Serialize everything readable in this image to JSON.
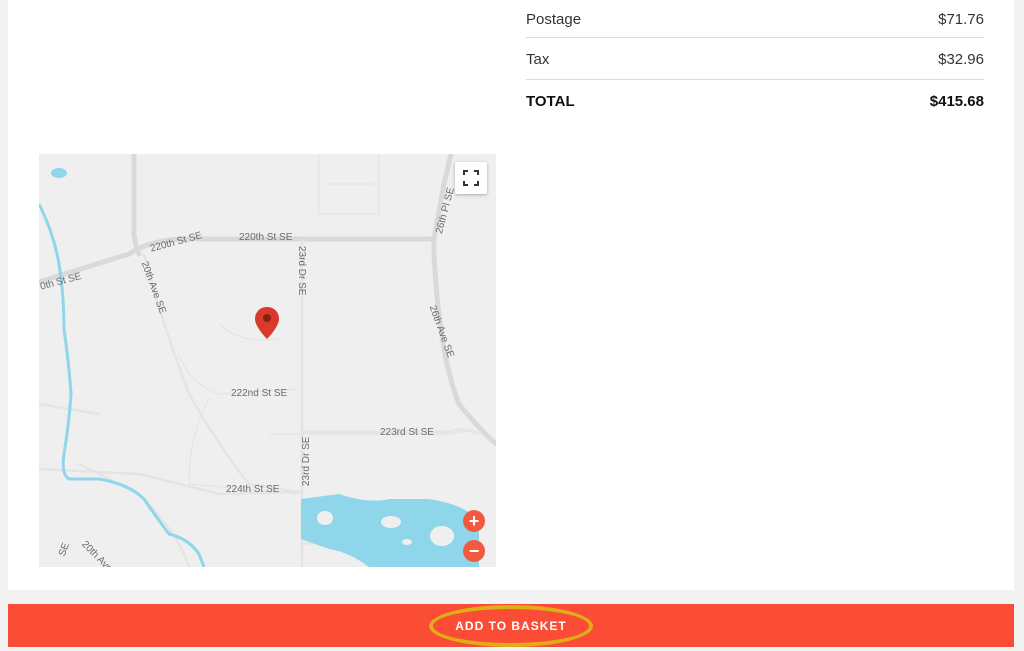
{
  "summary": {
    "postage_label": "Postage",
    "postage_value": "$71.76",
    "tax_label": "Tax",
    "tax_value": "$32.96",
    "total_label": "TOTAL",
    "total_value": "$415.68"
  },
  "map": {
    "roads": {
      "r220th_left": "220th St SE",
      "r220th_mid": "220th St SE",
      "r220th_edge": "0th St SE",
      "r20th_ave": "20th Ave SE",
      "r23rd_dr_top": "23rd Dr SE",
      "r23rd_dr_bottom": "23rd Dr SE",
      "r26th_pl": "26th Pl SE",
      "r26th_ave": "26th Ave SE",
      "r222nd": "222nd St SE",
      "r223rd": "223rd St SE",
      "r224th": "224th St SE",
      "r20th_ave_bottom": "20th Ave",
      "r_se_bottom": "SE"
    },
    "controls": {
      "zoom_in": "+",
      "zoom_out": "−"
    },
    "colors": {
      "water": "#8fd6ea",
      "marker": "#d93a2b",
      "background": "#efefef"
    }
  },
  "actions": {
    "add_to_basket": "ADD TO BASKET"
  }
}
